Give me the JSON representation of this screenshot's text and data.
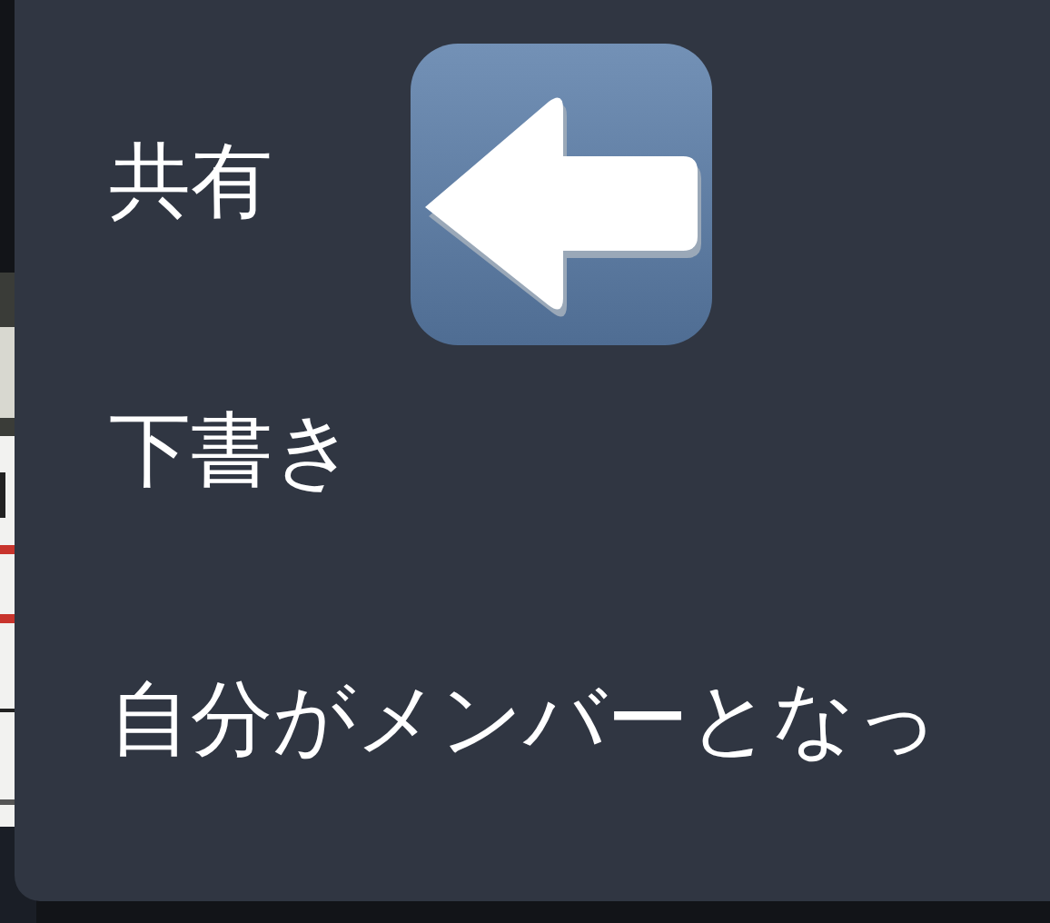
{
  "menu": {
    "items": [
      {
        "label": "共有"
      },
      {
        "label": "下書き"
      },
      {
        "label": "自分がメンバーとなっ"
      }
    ]
  },
  "overlay": {
    "kind": "emoji-arrow"
  }
}
